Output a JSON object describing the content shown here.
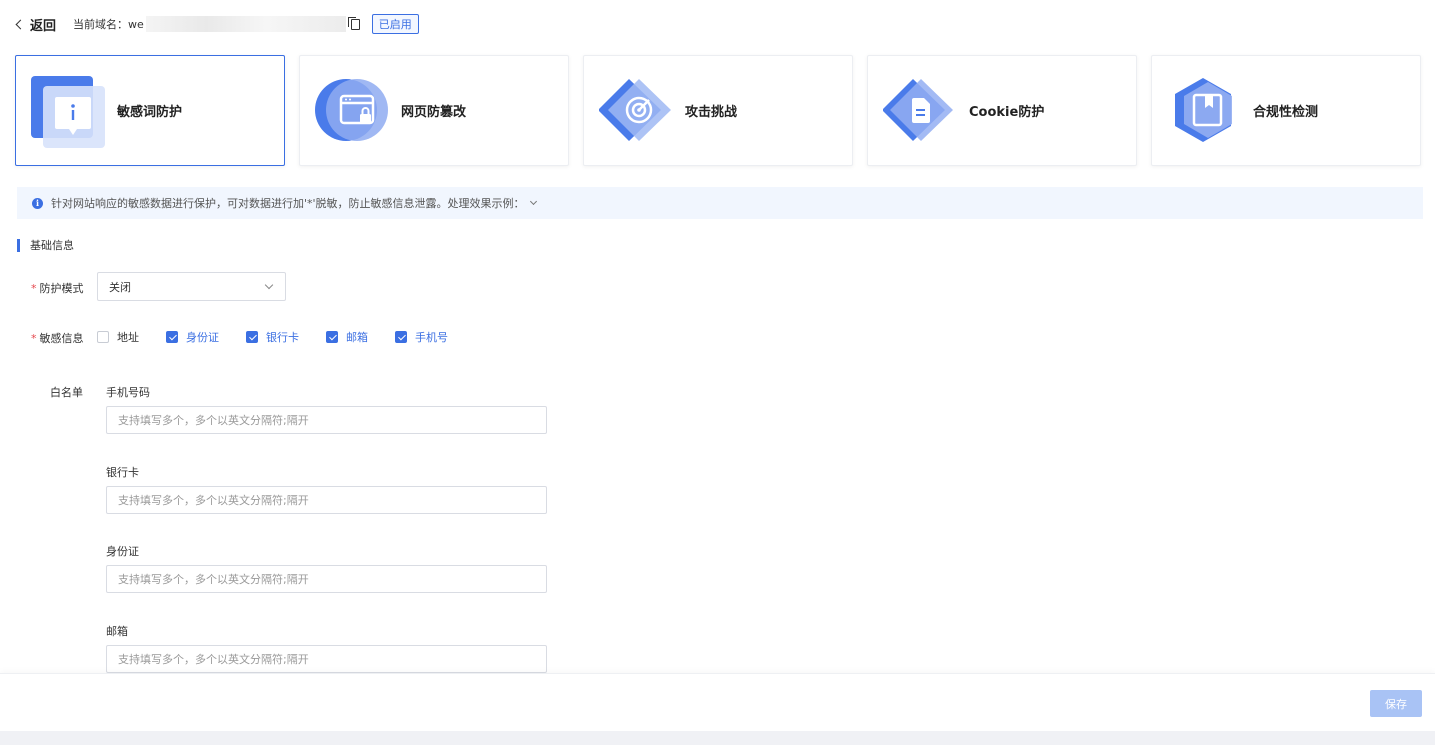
{
  "header": {
    "back_label": "返回",
    "domain_label": "当前域名：",
    "domain_value": "we",
    "status_badge": "已启用"
  },
  "cards": [
    {
      "title": "敏感词防护",
      "icon": "sensitive-word-icon",
      "active": true
    },
    {
      "title": "网页防篡改",
      "icon": "webpage-lock-icon",
      "active": false
    },
    {
      "title": "攻击挑战",
      "icon": "target-icon",
      "active": false
    },
    {
      "title": "Cookie防护",
      "icon": "document-icon",
      "active": false
    },
    {
      "title": "合规性检测",
      "icon": "bookmark-icon",
      "active": false
    }
  ],
  "banner": {
    "text": "针对网站响应的敏感数据进行保护，可对数据进行加'*'脱敏，防止敏感信息泄露。处理效果示例："
  },
  "section": {
    "title": "基础信息"
  },
  "form": {
    "mode_label": "防护模式",
    "mode_value": "关闭",
    "sensitive_label": "敏感信息",
    "checkboxes": [
      {
        "label": "地址",
        "checked": false
      },
      {
        "label": "身份证",
        "checked": true
      },
      {
        "label": "银行卡",
        "checked": true
      },
      {
        "label": "邮箱",
        "checked": true
      },
      {
        "label": "手机号",
        "checked": true
      }
    ],
    "whitelist_label": "白名单",
    "whitelist": [
      {
        "label": "手机号码",
        "placeholder": "支持填写多个，多个以英文分隔符;隔开",
        "value": ""
      },
      {
        "label": "银行卡",
        "placeholder": "支持填写多个，多个以英文分隔符;隔开",
        "value": ""
      },
      {
        "label": "身份证",
        "placeholder": "支持填写多个，多个以英文分隔符;隔开",
        "value": ""
      },
      {
        "label": "邮箱",
        "placeholder": "支持填写多个，多个以英文分隔符;隔开",
        "value": ""
      }
    ]
  },
  "footer": {
    "save_label": "保存"
  },
  "colors": {
    "accent": "#3b6fe2",
    "banner_bg": "#f1f6fe",
    "save_disabled": "#a9c3f5"
  }
}
